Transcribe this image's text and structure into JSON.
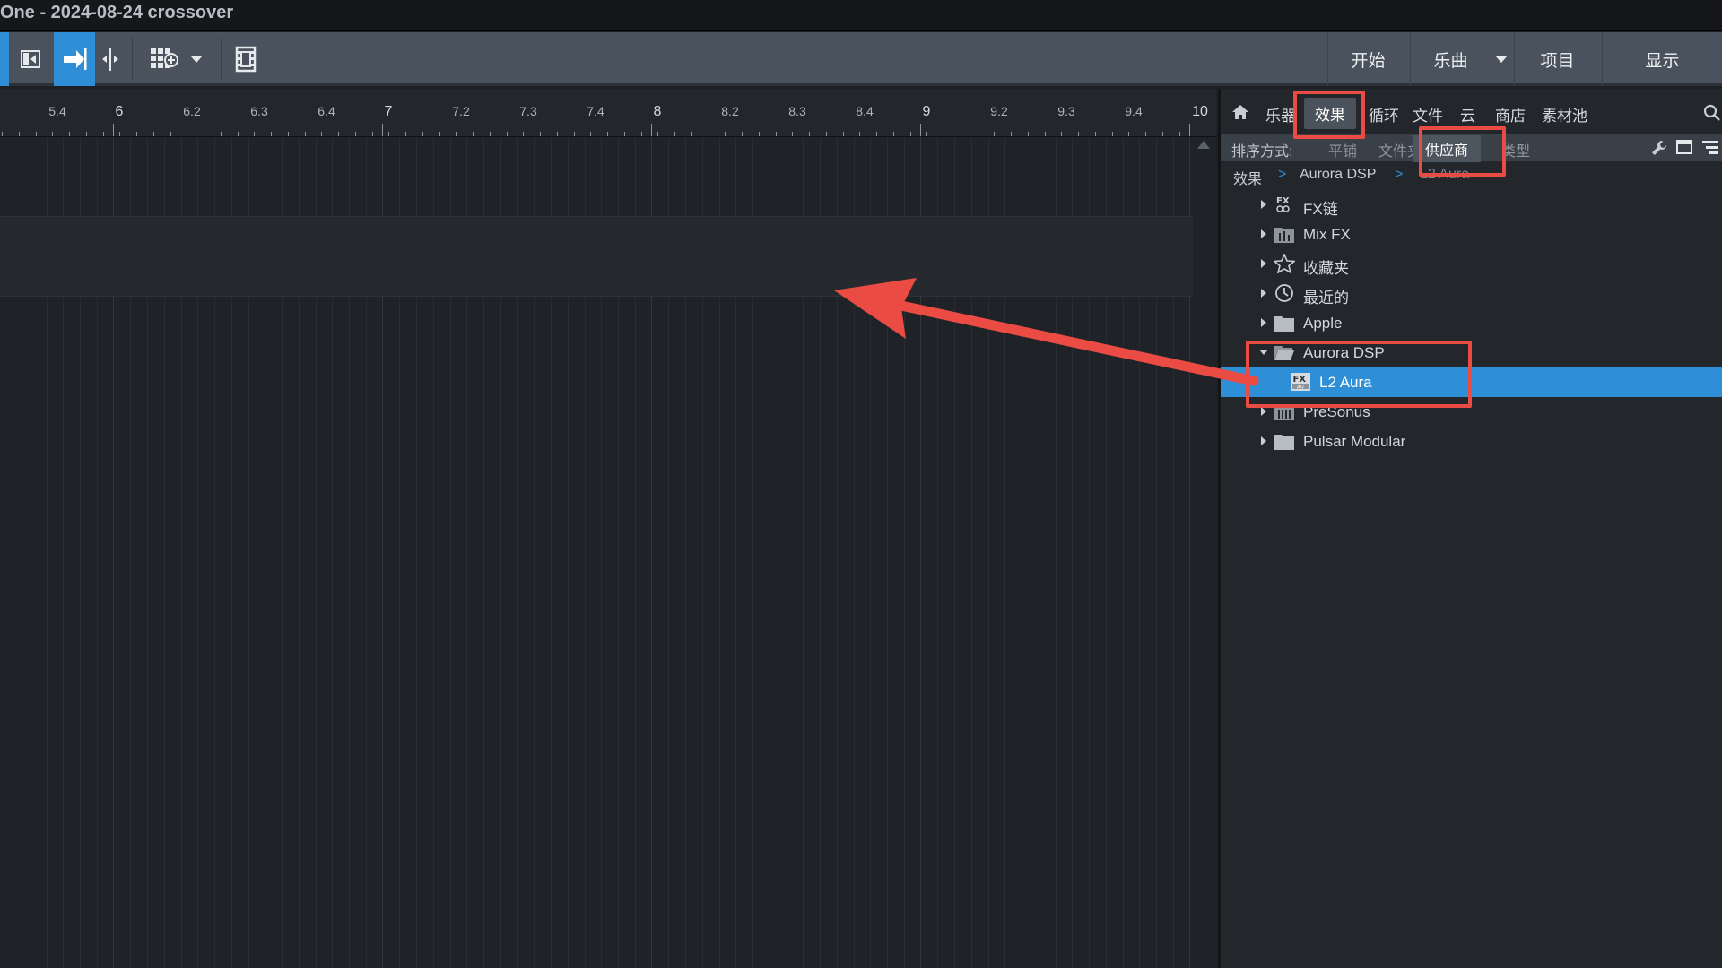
{
  "window": {
    "title": "One - 2024-08-24 crossover"
  },
  "toolbar": {
    "buttons": [
      {
        "name": "start",
        "label": "开始"
      },
      {
        "name": "song",
        "label": "乐曲"
      },
      {
        "name": "project",
        "label": "项目"
      },
      {
        "name": "show",
        "label": "显示"
      }
    ]
  },
  "ruler": {
    "labels": [
      {
        "value": "5.4",
        "major": false
      },
      {
        "value": "6",
        "major": true
      },
      {
        "value": "6.2",
        "major": false
      },
      {
        "value": "6.3",
        "major": false
      },
      {
        "value": "6.4",
        "major": false
      },
      {
        "value": "7",
        "major": true
      },
      {
        "value": "7.2",
        "major": false
      },
      {
        "value": "7.3",
        "major": false
      },
      {
        "value": "7.4",
        "major": false
      },
      {
        "value": "8",
        "major": true
      },
      {
        "value": "8.2",
        "major": false
      },
      {
        "value": "8.3",
        "major": false
      },
      {
        "value": "8.4",
        "major": false
      },
      {
        "value": "9",
        "major": true
      },
      {
        "value": "9.2",
        "major": false
      },
      {
        "value": "9.3",
        "major": false
      },
      {
        "value": "9.4",
        "major": false
      },
      {
        "value": "10",
        "major": true
      }
    ]
  },
  "browser": {
    "tabs": [
      {
        "label": "乐器",
        "selected": false
      },
      {
        "label": "效果",
        "selected": true
      },
      {
        "label": "循环",
        "selected": false
      },
      {
        "label": "文件",
        "selected": false
      },
      {
        "label": "云",
        "selected": false
      },
      {
        "label": "商店",
        "selected": false
      },
      {
        "label": "素材池",
        "selected": false
      }
    ],
    "sort": {
      "label": "排序方式:",
      "options": [
        {
          "label": "平铺",
          "selected": false
        },
        {
          "label": "文件夹",
          "selected": false
        },
        {
          "label": "供应商",
          "selected": true
        },
        {
          "label": "类型",
          "selected": false
        }
      ]
    },
    "breadcrumb": [
      "效果",
      "Aurora DSP",
      "L2 Aura"
    ],
    "tree": [
      {
        "label": "FX链",
        "icon": "fx-chain-icon",
        "expandable": true,
        "expanded": false,
        "level": 0,
        "selected": false
      },
      {
        "label": "Mix FX",
        "icon": "mix-fx-folder-icon",
        "expandable": true,
        "expanded": false,
        "level": 0,
        "selected": false
      },
      {
        "label": "收藏夹",
        "icon": "star-icon",
        "expandable": true,
        "expanded": false,
        "level": 0,
        "selected": false
      },
      {
        "label": "最近的",
        "icon": "clock-icon",
        "expandable": true,
        "expanded": false,
        "level": 0,
        "selected": false
      },
      {
        "label": "Apple",
        "icon": "folder-icon",
        "expandable": true,
        "expanded": false,
        "level": 0,
        "selected": false
      },
      {
        "label": "Aurora DSP",
        "icon": "folder-open-icon",
        "expandable": true,
        "expanded": true,
        "level": 0,
        "selected": false
      },
      {
        "label": "L2 Aura",
        "icon": "fx-au-plugin-icon",
        "expandable": false,
        "expanded": false,
        "level": 1,
        "selected": true
      },
      {
        "label": "PreSonus",
        "icon": "presonus-folder-icon",
        "expandable": true,
        "expanded": false,
        "level": 0,
        "selected": false
      },
      {
        "label": "Pulsar Modular",
        "icon": "folder-icon",
        "expandable": true,
        "expanded": false,
        "level": 0,
        "selected": false
      }
    ]
  },
  "colors": {
    "accent": "#2f8fd6",
    "annotation": "#ea4b42",
    "toolbar": "#49525d",
    "panel": "#23272c"
  }
}
